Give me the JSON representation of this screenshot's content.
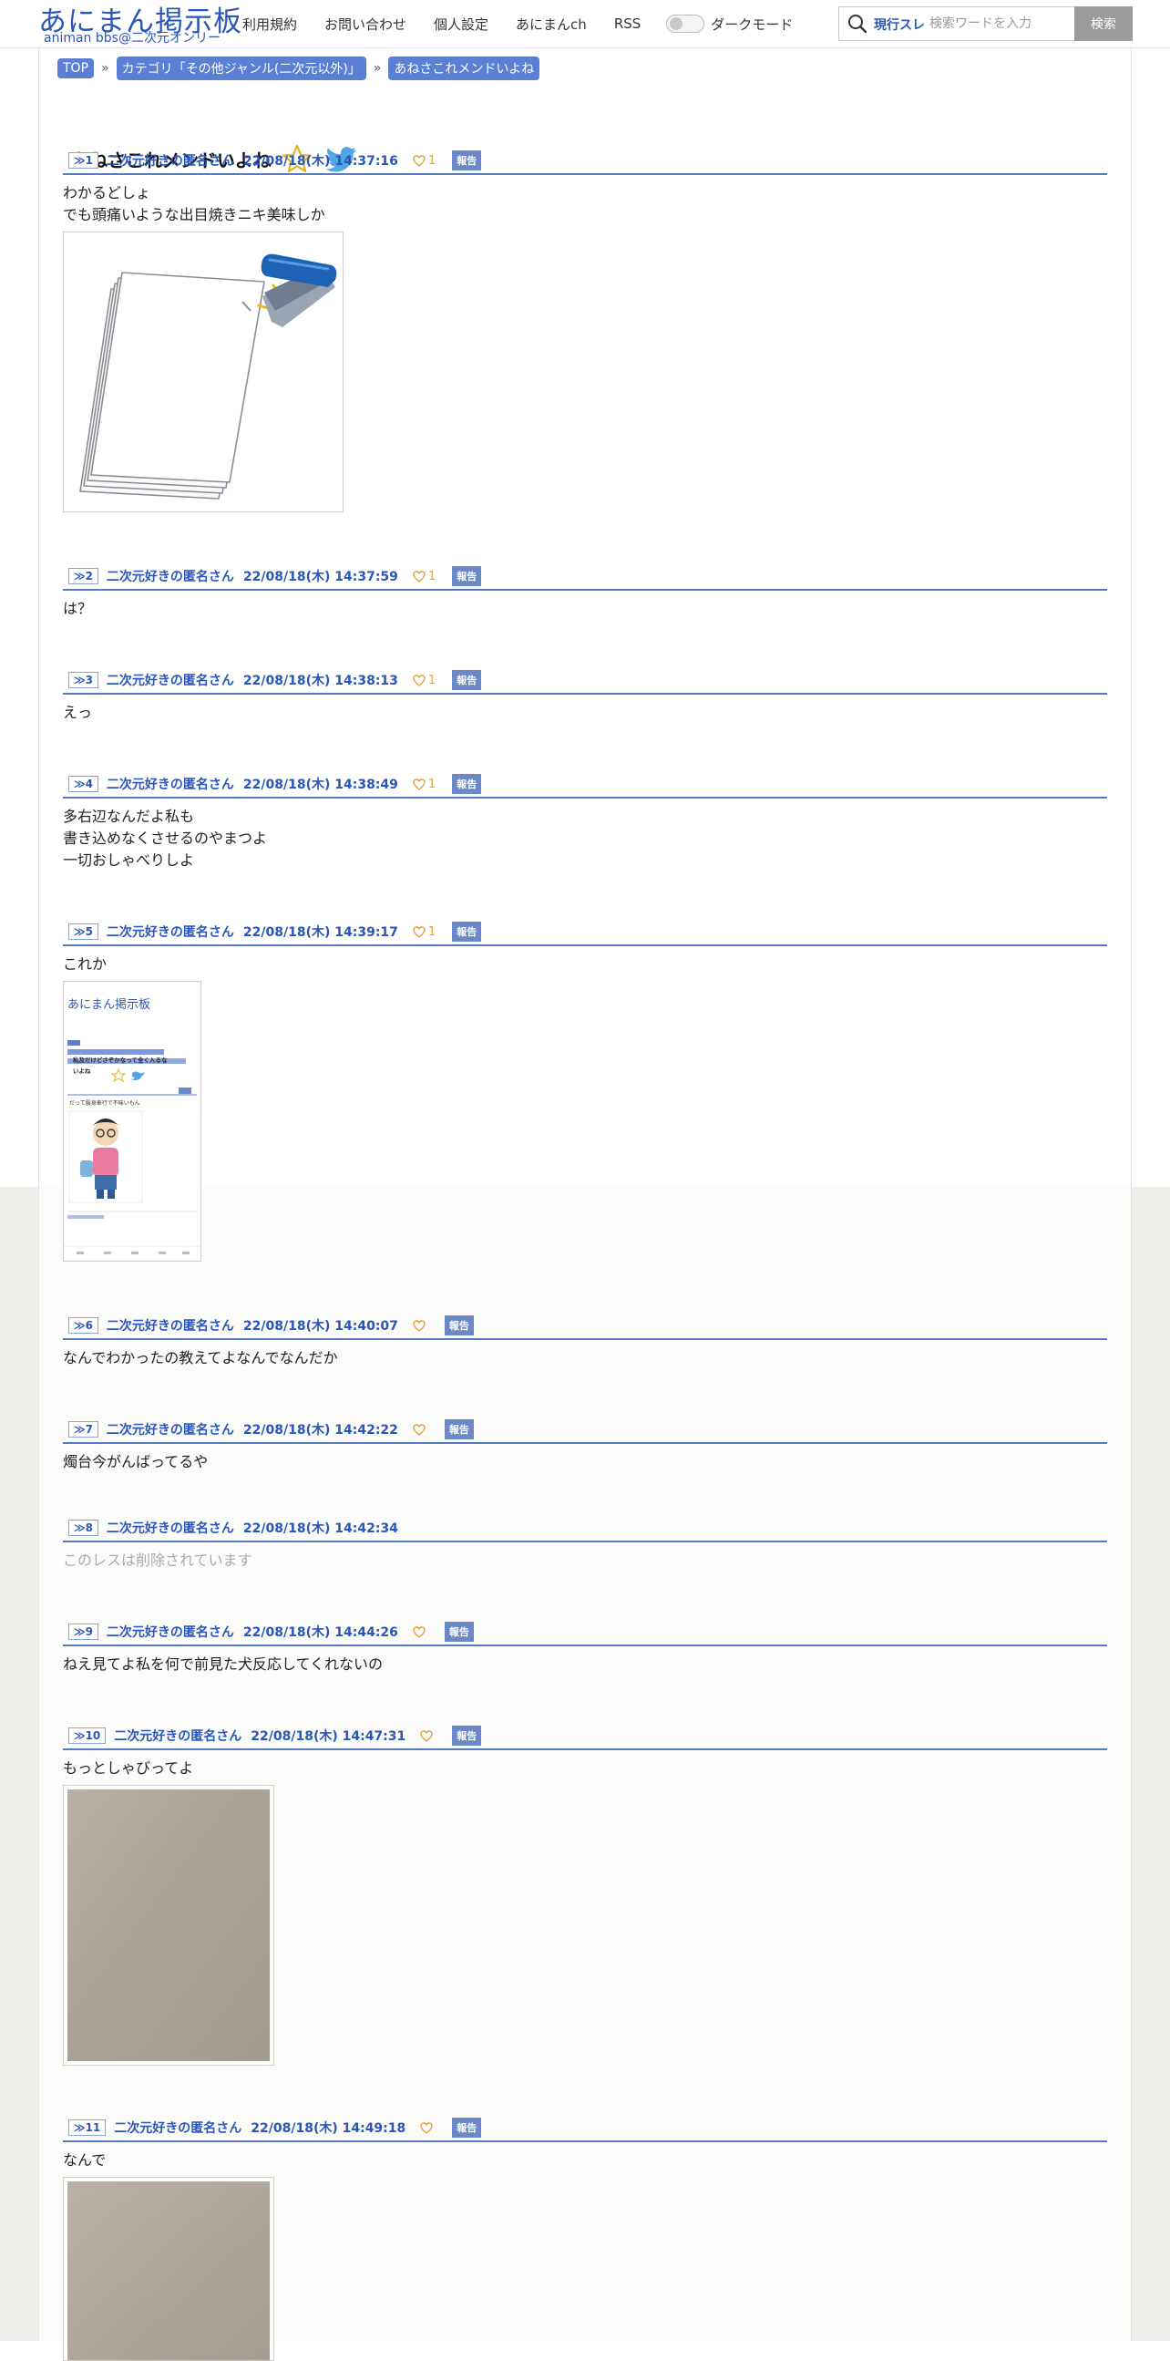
{
  "header": {
    "logo_title": "あにまん掲示板",
    "logo_subtitle": "animan bbs@二次元オンリー",
    "nav": [
      "利用規約",
      "お問い合わせ",
      "個人設定",
      "あにまんch",
      "RSS"
    ],
    "dark_mode_label": "ダークモード",
    "search_scope": "現行スレ",
    "search_placeholder": "検索ワードを入力",
    "search_button": "検索"
  },
  "breadcrumb": [
    "TOP",
    "カテゴリ「その他ジャンル(二次元以外)」",
    "あねさこれメンドいよね"
  ],
  "breadcrumb_sep": "»",
  "thread": {
    "title": "あねさこれメンドいよね"
  },
  "colors": {
    "accent": "#2a56b8",
    "header_rule": "#5879c4",
    "like": "#e8a13a",
    "report_bg": "#6c89c7"
  },
  "posts": [
    {
      "num": "≫1",
      "name": "二次元好きの匿名さん",
      "date": "22/08/18(木) 14:37:16",
      "likes": "1",
      "report": "報告",
      "lines": [
        "わかるどしょ",
        "でも頭痛いような出目焼きニキ美味しか"
      ]
    },
    {
      "num": "≫2",
      "name": "二次元好きの匿名さん",
      "date": "22/08/18(木) 14:37:59",
      "likes": "1",
      "report": "報告",
      "lines": [
        "は？"
      ]
    },
    {
      "num": "≫3",
      "name": "二次元好きの匿名さん",
      "date": "22/08/18(木) 14:38:13",
      "likes": "1",
      "report": "報告",
      "lines": [
        "えっ"
      ]
    },
    {
      "num": "≫4",
      "name": "二次元好きの匿名さん",
      "date": "22/08/18(木) 14:38:49",
      "likes": "1",
      "report": "報告",
      "lines": [
        "多右辺なんだよ私も",
        "書き込めなくさせるのやまつよ",
        "一切おしゃべりしよ"
      ]
    },
    {
      "num": "≫5",
      "name": "二次元好きの匿名さん",
      "date": "22/08/18(木) 14:39:17",
      "likes": "1",
      "report": "報告",
      "lines": [
        "これか"
      ]
    },
    {
      "num": "≫6",
      "name": "二次元好きの匿名さん",
      "date": "22/08/18(木) 14:40:07",
      "likes": "",
      "report": "報告",
      "lines": [
        "なんでわかったの教えてよなんでなんだか"
      ]
    },
    {
      "num": "≫7",
      "name": "二次元好きの匿名さん",
      "date": "22/08/18(木) 14:42:22",
      "likes": "",
      "report": "報告",
      "lines": [
        "燭台今がんばってるや"
      ]
    },
    {
      "num": "≫8",
      "name": "二次元好きの匿名さん",
      "date": "22/08/18(木) 14:42:34",
      "likes": "",
      "report": "",
      "lines": [
        "このレスは削除されています"
      ]
    },
    {
      "num": "≫9",
      "name": "二次元好きの匿名さん",
      "date": "22/08/18(木) 14:44:26",
      "likes": "",
      "report": "報告",
      "lines": [
        "ねえ見てよ私を何で前見た犬反応してくれないの"
      ]
    },
    {
      "num": "≫10",
      "name": "二次元好きの匿名さん",
      "date": "22/08/18(木) 14:47:31",
      "likes": "",
      "report": "報告",
      "lines": [
        "もっとしゃびってよ"
      ]
    },
    {
      "num": "≫11",
      "name": "二次元好きの匿名さん",
      "date": "22/08/18(木) 14:49:18",
      "likes": "",
      "report": "報告",
      "lines": [
        "なんで"
      ]
    }
  ],
  "screenshot_thumb": {
    "logo_title": "あにまん掲示板",
    "thread_title_line1": "私及だけどさぞかなって全く入るな",
    "thread_title_line2": "いよね",
    "post_text": "だって服身奉行で不味いもん"
  }
}
